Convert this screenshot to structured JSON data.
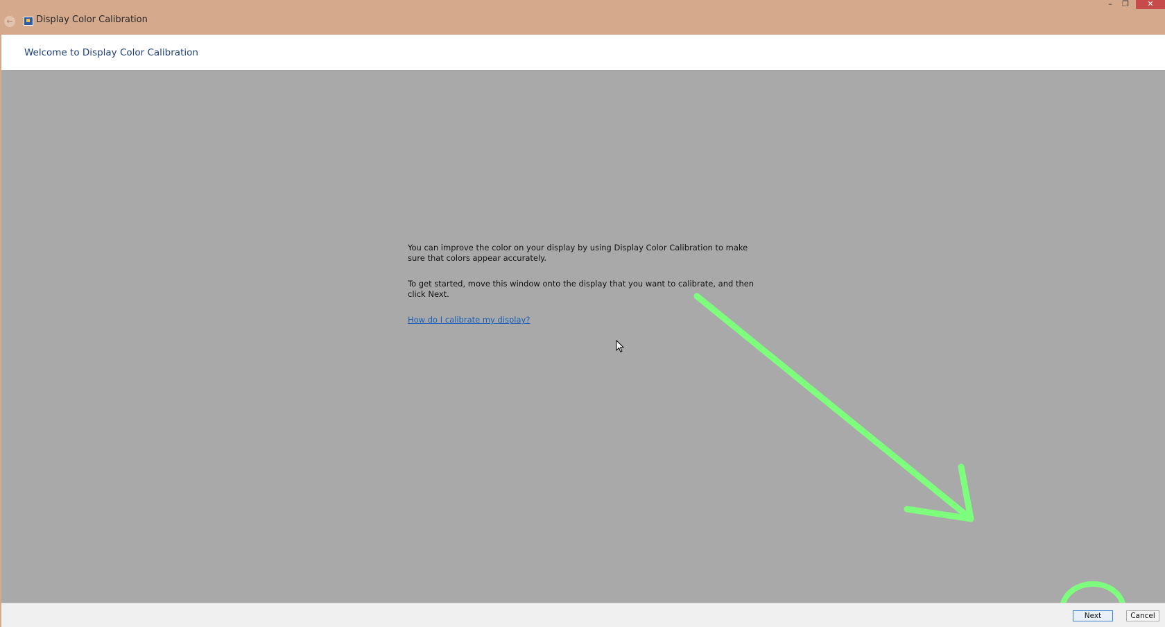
{
  "window": {
    "title": "Display Color Calibration",
    "icons": {
      "back": "back-arrow-icon",
      "app": "display-calibration-icon",
      "minimize": "minimize-icon",
      "maximize": "restore-icon",
      "close": "close-icon"
    },
    "controls": {
      "minimize_glyph": "–",
      "maximize_glyph": "❐",
      "close_glyph": "✕"
    },
    "titlebar_color": "#d4a98c",
    "close_color": "#c74b4b"
  },
  "header": {
    "title": "Welcome to Display Color Calibration"
  },
  "content": {
    "paragraph_1": "You can improve the color on your display by using Display Color Calibration to make sure that colors appear accurately.",
    "paragraph_2": "To get started, move this window onto the display that you want to calibrate, and then click Next.",
    "help_link": "How do I calibrate my display?"
  },
  "footer": {
    "next_label": "Next",
    "cancel_label": "Cancel"
  },
  "annotation": {
    "color": "#7dff7d",
    "type": "arrow-and-circle-highlighting-next-button"
  }
}
